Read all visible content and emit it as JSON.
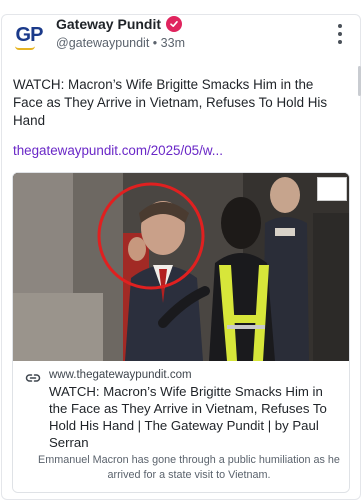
{
  "post": {
    "author_name": "Gateway Pundit",
    "avatar_text": "GP",
    "handle": "@gatewaypundit",
    "separator": "•",
    "time": "33m",
    "text": "WATCH: Macron’s Wife Brigitte Smacks Him in the Face as They Arrive in Vietnam, Refuses To Hold His Hand",
    "link_text": "thegatewaypundit.com/2025/05/w..."
  },
  "preview": {
    "domain": "www.thegatewaypundit.com",
    "title": "WATCH: Macron’s Wife Brigitte Smacks Him in the Face as They Arrive in Vietnam, Refuses To Hold His Hand | The Gateway Pundit | by Paul Serran",
    "description": "Emmanuel Macron has gone through a public humiliation as he arrived for a state visit to Vietnam."
  },
  "colors": {
    "link": "#6a28c7",
    "verified": "#e0245e",
    "highlight_circle": "#e02020",
    "avatar_text": "#1b3a8a"
  },
  "icons": {
    "verified": "verified-badge-icon",
    "more": "more-options-icon",
    "link": "link-icon"
  }
}
